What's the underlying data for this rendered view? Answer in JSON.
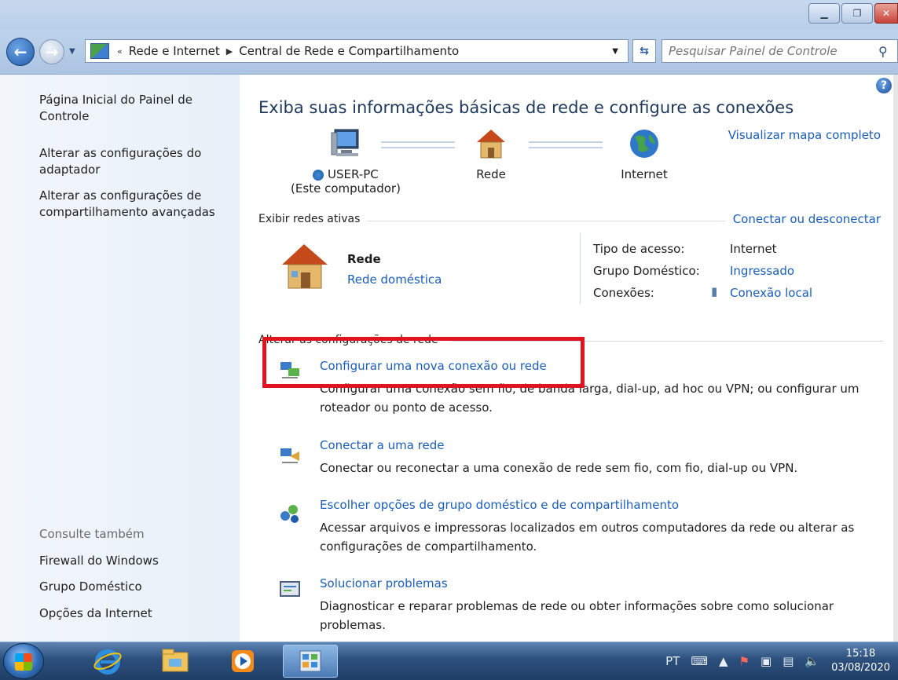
{
  "window": {
    "minimize_label": "▁",
    "maximize_label": "❐",
    "close_label": "✕"
  },
  "address": {
    "overflow_label": "«",
    "crumbs": [
      "Rede e Internet",
      "Central de Rede e Compartilhamento"
    ],
    "search_placeholder": "Pesquisar Painel de Controle"
  },
  "sidebar": {
    "items": [
      {
        "label": "Página Inicial do Painel de Controle"
      },
      {
        "label": "Alterar as configurações do adaptador"
      },
      {
        "label": "Alterar as configurações de compartilhamento avançadas"
      }
    ],
    "see_also_title": "Consulte também",
    "see_also": [
      {
        "label": "Firewall do Windows"
      },
      {
        "label": "Grupo Doméstico"
      },
      {
        "label": "Opções da Internet"
      }
    ]
  },
  "main": {
    "title": "Exiba suas informações básicas de rede e configure as conexões",
    "map_link": "Visualizar mapa completo",
    "nodes": {
      "computer_name": "USER-PC",
      "computer_sub": "(Este computador)",
      "network": "Rede",
      "internet": "Internet"
    },
    "active_networks_header": "Exibir redes ativas",
    "connect_link": "Conectar ou desconectar",
    "active_network": {
      "name": "Rede",
      "type_link": "Rede doméstica",
      "access_type_label": "Tipo de acesso:",
      "access_type_value": "Internet",
      "homegroup_label": "Grupo Doméstico:",
      "homegroup_value": "Ingressado",
      "connections_label": "Conexões:",
      "connections_value": "Conexão local"
    },
    "change_settings_header": "Alterar as configurações de rede",
    "tasks": [
      {
        "link": "Configurar uma nova conexão ou rede",
        "desc": "Configurar uma conexão sem fio, de banda larga, dial-up, ad hoc ou VPN; ou configurar um roteador ou ponto de acesso."
      },
      {
        "link": "Conectar a uma rede",
        "desc": "Conectar ou reconectar a uma conexão de rede sem fio, com fio, dial-up ou VPN."
      },
      {
        "link": "Escolher opções de grupo doméstico e de compartilhamento",
        "desc": "Acessar arquivos e impressoras localizados em outros computadores da rede ou alterar as configurações de compartilhamento."
      },
      {
        "link": "Solucionar problemas",
        "desc": "Diagnosticar e reparar problemas de rede ou obter informações sobre como solucionar problemas."
      }
    ]
  },
  "taskbar": {
    "language": "PT",
    "time": "15:18",
    "date": "03/08/2020"
  },
  "colors": {
    "link": "#1b5eb8",
    "highlight": "#e0141e"
  }
}
